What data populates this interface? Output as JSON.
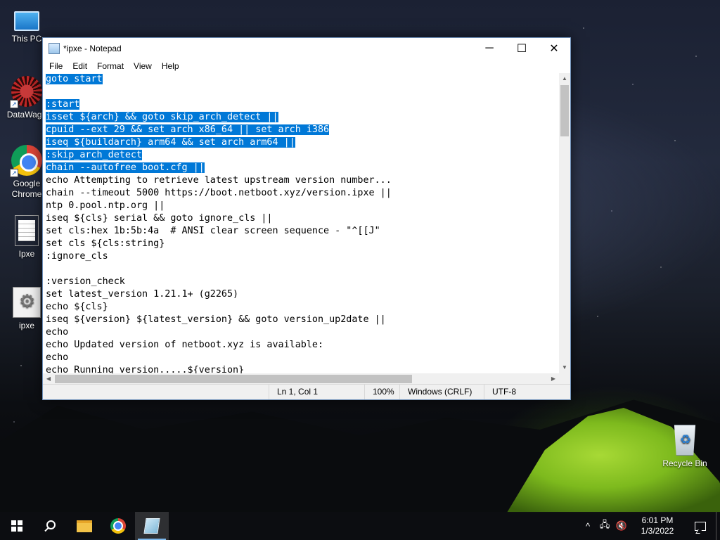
{
  "desktop": {
    "icons": [
      {
        "label": "This PC",
        "icon": "computer-icon"
      },
      {
        "label": "DataWago",
        "icon": "datawago-icon"
      },
      {
        "label": "Google Chrome",
        "icon": "chrome-icon"
      },
      {
        "label": "Ipxe",
        "icon": "text-file-icon"
      },
      {
        "label": "ipxe",
        "icon": "config-file-icon"
      },
      {
        "label": "Recycle Bin",
        "icon": "recycle-bin-icon"
      }
    ]
  },
  "notepad": {
    "title": "*ipxe - Notepad",
    "controls": {
      "minimize": "─",
      "maximize": "☐",
      "close": "✕"
    },
    "menu": [
      "File",
      "Edit",
      "Format",
      "View",
      "Help"
    ],
    "lines": [
      {
        "text": "goto start",
        "selected": true
      },
      {
        "text": "",
        "selected": false
      },
      {
        "text": ":start",
        "selected": true
      },
      {
        "text": "isset ${arch} && goto skip_arch_detect ||",
        "selected": true
      },
      {
        "text": "cpuid --ext 29 && set arch x86_64 || set arch i386",
        "selected": true
      },
      {
        "text": "iseq ${buildarch} arm64 && set arch arm64 ||",
        "selected": true
      },
      {
        "text": ":skip_arch_detect",
        "selected": true
      },
      {
        "text": "chain --autofree boot.cfg ||",
        "selected": true
      },
      {
        "text": "echo Attempting to retrieve latest upstream version number...",
        "selected": false
      },
      {
        "text": "chain --timeout 5000 https://boot.netboot.xyz/version.ipxe ||",
        "selected": false
      },
      {
        "text": "ntp 0.pool.ntp.org ||",
        "selected": false
      },
      {
        "text": "iseq ${cls} serial && goto ignore_cls ||",
        "selected": false
      },
      {
        "text": "set cls:hex 1b:5b:4a  # ANSI clear screen sequence - \"^[[J\"",
        "selected": false
      },
      {
        "text": "set cls ${cls:string}",
        "selected": false
      },
      {
        "text": ":ignore_cls",
        "selected": false
      },
      {
        "text": "",
        "selected": false
      },
      {
        "text": ":version_check",
        "selected": false
      },
      {
        "text": "set latest_version 1.21.1+ (g2265)",
        "selected": false
      },
      {
        "text": "echo ${cls}",
        "selected": false
      },
      {
        "text": "iseq ${version} ${latest_version} && goto version_up2date ||",
        "selected": false
      },
      {
        "text": "echo",
        "selected": false
      },
      {
        "text": "echo Updated version of netboot.xyz is available:",
        "selected": false
      },
      {
        "text": "echo",
        "selected": false
      },
      {
        "text": "echo Running version.....${version}",
        "selected": false
      }
    ],
    "status": {
      "position": "Ln 1, Col 1",
      "zoom": "100%",
      "line_ending": "Windows (CRLF)",
      "encoding": "UTF-8"
    }
  },
  "taskbar": {
    "apps": [
      {
        "name": "start",
        "icon": "windows-logo-icon"
      },
      {
        "name": "search",
        "icon": "search-icon"
      },
      {
        "name": "file-explorer",
        "icon": "folder-icon"
      },
      {
        "name": "chrome",
        "icon": "chrome-icon"
      },
      {
        "name": "notepad",
        "icon": "notepad-icon",
        "active": true
      }
    ],
    "tray": {
      "chevron": "^",
      "time": "6:01 PM",
      "date": "1/3/2022"
    }
  },
  "colors": {
    "selection": "#0078d7",
    "taskbar": "#0c0e12",
    "tent_glow": "#9ee02a"
  }
}
